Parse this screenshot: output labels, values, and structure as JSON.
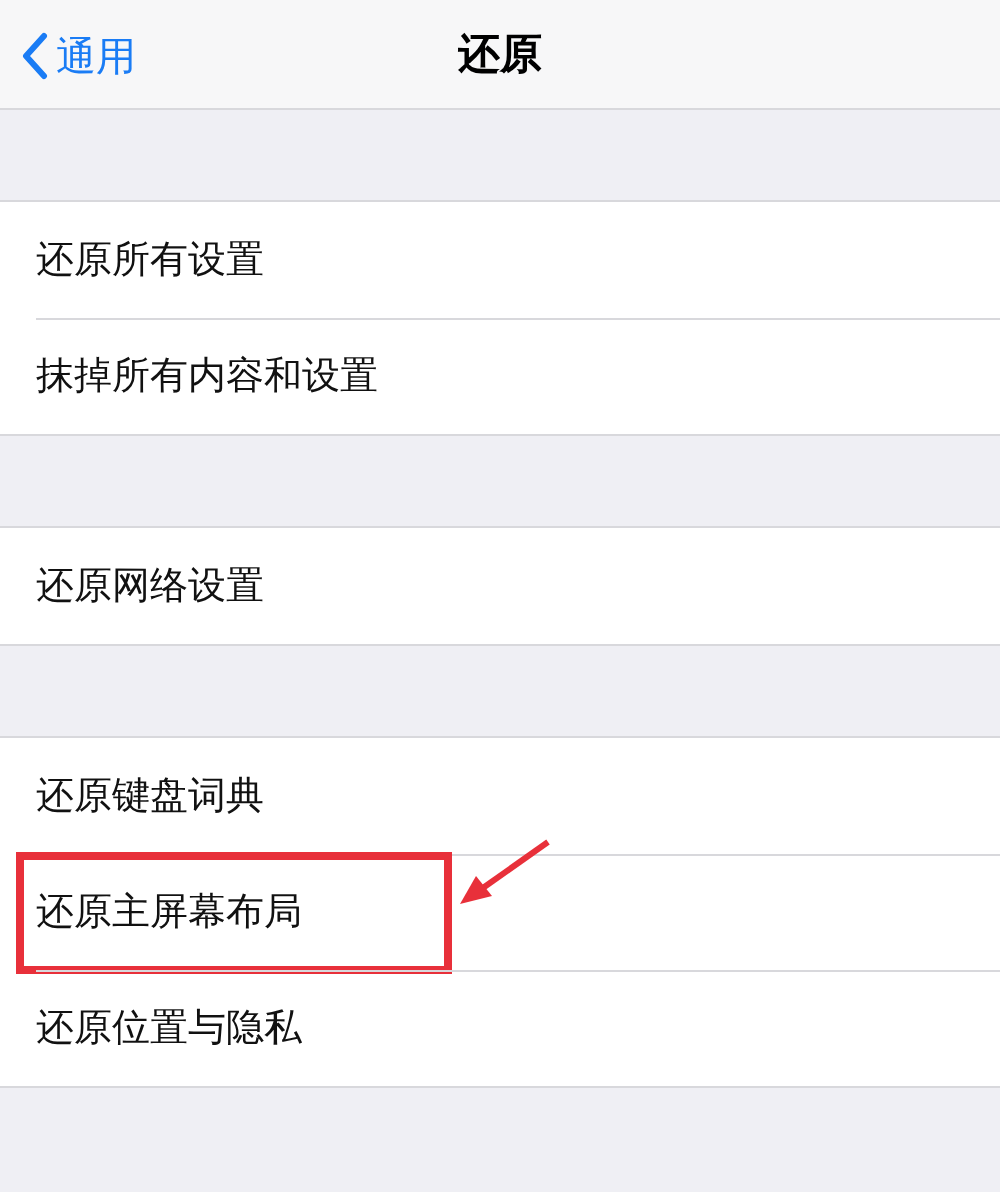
{
  "nav_bar": {
    "back_label": "通用",
    "title": "还原"
  },
  "groups": [
    {
      "items": [
        {
          "label": "还原所有设置",
          "highlighted": false
        },
        {
          "label": "抹掉所有内容和设置",
          "highlighted": false
        }
      ]
    },
    {
      "items": [
        {
          "label": "还原网络设置",
          "highlighted": false
        }
      ]
    },
    {
      "items": [
        {
          "label": "还原键盘词典",
          "highlighted": false
        },
        {
          "label": "还原主屏幕布局",
          "highlighted": true
        },
        {
          "label": "还原位置与隐私",
          "highlighted": false
        }
      ]
    }
  ]
}
